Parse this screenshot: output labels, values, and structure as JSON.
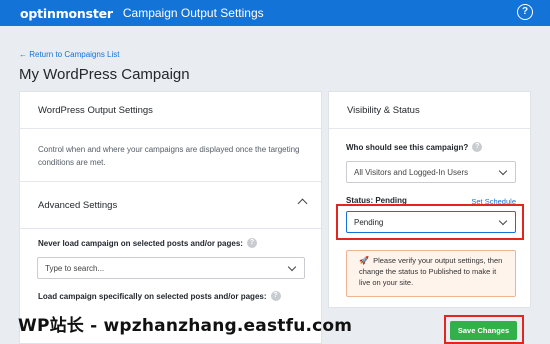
{
  "header": {
    "logo_text": "optinmonster",
    "title": "Campaign Output Settings",
    "help_glyph": "?"
  },
  "breadcrumb": {
    "back_label": "← Return to Campaigns List"
  },
  "page": {
    "title": "My WordPress Campaign"
  },
  "output_settings": {
    "heading": "WordPress Output Settings",
    "description": "Control when and where your campaigns are displayed once the targeting conditions are met."
  },
  "advanced": {
    "heading": "Advanced Settings",
    "never_load_label": "Never load campaign on selected posts and/or pages:",
    "search_placeholder": "Type to search...",
    "load_specific_label": "Load campaign specifically on selected posts and/or pages:"
  },
  "visibility": {
    "heading": "Visibility & Status",
    "who_label": "Who should see this campaign?",
    "who_value": "All Visitors and Logged-In Users",
    "status_label": "Status: Pending",
    "set_schedule": "Set Schedule",
    "status_value": "Pending",
    "notice_icon": "🚀",
    "notice_text": "Please verify your output settings, then change the status to Published to make it live on your site."
  },
  "footer": {
    "watermark": "WP站长 - wpzhanzhang.eastfu.com",
    "save_label": "Save Changes"
  },
  "colors": {
    "brand": "#1473d7",
    "save": "#34b04a",
    "highlight": "#e0261f",
    "notice_bg": "#fff4ec"
  }
}
